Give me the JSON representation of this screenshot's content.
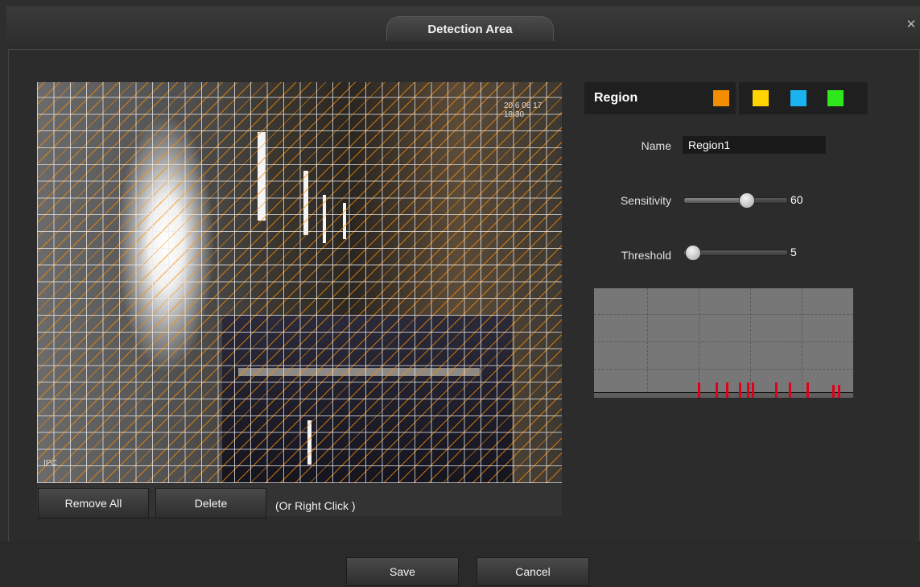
{
  "dialog": {
    "title": "Detection Area",
    "close_icon": "close-icon"
  },
  "video": {
    "osd_time": "20 6 06 17 18:30",
    "osd_name": "IPC"
  },
  "toolbar": {
    "remove_all_label": "Remove All",
    "delete_label": "Delete",
    "hint": "(Or Right Click )"
  },
  "region": {
    "label": "Region",
    "colors": [
      "#f28c00",
      "#ffd400",
      "#1ab2f0",
      "#2ee81c"
    ],
    "selected_color": "#f28c00"
  },
  "form": {
    "name_label": "Name",
    "name_value": "Region1",
    "sensitivity_label": "Sensitivity",
    "sensitivity_value": "60",
    "sensitivity_fraction": 0.6,
    "threshold_label": "Threshold",
    "threshold_value": "5",
    "threshold_fraction": 0.05
  },
  "graph": {
    "line_color": "#e0001a",
    "bars": [
      {
        "x": 0.4,
        "h": 0.14
      },
      {
        "x": 0.47,
        "h": 0.14
      },
      {
        "x": 0.51,
        "h": 0.14
      },
      {
        "x": 0.56,
        "h": 0.14
      },
      {
        "x": 0.59,
        "h": 0.14
      },
      {
        "x": 0.61,
        "h": 0.14
      },
      {
        "x": 0.7,
        "h": 0.14
      },
      {
        "x": 0.75,
        "h": 0.14
      },
      {
        "x": 0.82,
        "h": 0.14
      },
      {
        "x": 0.92,
        "h": 0.12
      },
      {
        "x": 0.94,
        "h": 0.12
      }
    ]
  },
  "footer": {
    "save_label": "Save",
    "cancel_label": "Cancel"
  }
}
